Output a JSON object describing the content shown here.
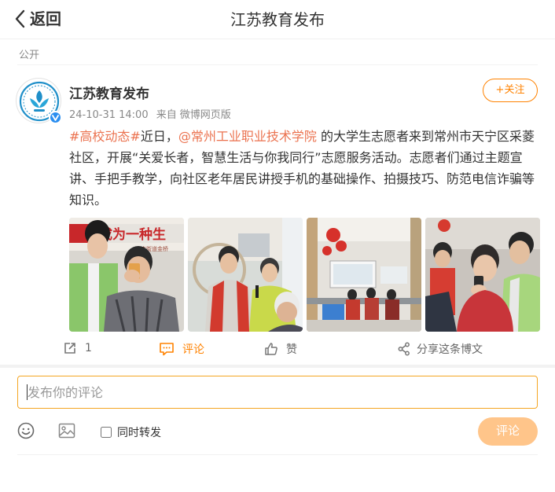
{
  "header": {
    "back_label": "返回",
    "title": "江苏教育发布"
  },
  "post": {
    "visibility": "公开",
    "author": "江苏教育发布",
    "time": "24-10-31 14:00",
    "source_prefix": "来自",
    "source": "微博网页版",
    "follow_label": "+关注",
    "text": {
      "topic": "#高校动态#",
      "part1": "近日，",
      "mention": "@常州工业职业技术学院",
      "part2": " 的大学生志愿者来到常州市天宁区采菱社区，开展“关爱长者，智慧生活与你我同行”志愿服务活动。志愿者们通过主题宣讲、手把手教学，向社区老年居民讲授手机的基础操作、拍摄技巧、防范电信诈骗等知识。"
    },
    "photo1_banner": "成为一种生",
    "photo1_caption": "局庄街道金桥"
  },
  "actions": {
    "repost_count": "1",
    "comment_label": "评论",
    "like_label": "赞",
    "share_label": "分享这条博文"
  },
  "composer": {
    "placeholder": "发布你的评论",
    "repost_label": "同时转发",
    "submit_label": "评论"
  },
  "colors": {
    "accent": "#ff8200",
    "link": "#eb7350",
    "submit_disabled": "#ffc58a"
  }
}
